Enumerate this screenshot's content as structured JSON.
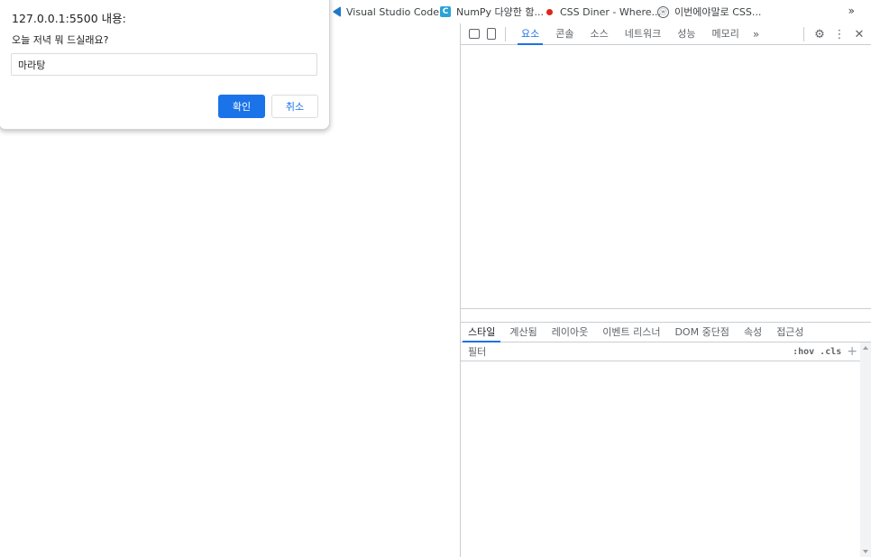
{
  "bookmarks": {
    "items": [
      {
        "label": "Visual Studio Code...",
        "icon": "vscode-icon"
      },
      {
        "label": "NumPy 다양한 함...",
        "icon": "numpy-icon",
        "icon_letter": "C"
      },
      {
        "label": "CSS Diner - Where...",
        "icon": "css-diner-icon"
      },
      {
        "label": "이번에야말로 CSS...",
        "icon": "github-icon",
        "icon_glyph": "ⓦ"
      }
    ],
    "more": "»"
  },
  "dialog": {
    "title": "127.0.0.1:5500 내용:",
    "message": "오늘 저녁 뭐 드실래요?",
    "input_value": "마라탕",
    "ok_label": "확인",
    "cancel_label": "취소"
  },
  "devtools": {
    "tabs": [
      "요소",
      "콘솔",
      "소스",
      "네트워크",
      "성능",
      "메모리"
    ],
    "active_tab": "요소",
    "more_tabs": "»",
    "icons": {
      "settings": "⚙",
      "menu": "⋮",
      "close": "✕"
    },
    "styles_tabs": [
      "스타일",
      "계산됨",
      "레이아웃",
      "이벤트 리스너",
      "DOM 중단점",
      "속성",
      "접근성"
    ],
    "active_styles_tab": "스타일",
    "filter_placeholder": "필터",
    "hov": ":hov",
    "cls": ".cls",
    "plus": "+"
  },
  "colors": {
    "accent": "#1a73e8",
    "border": "#cbcdd1"
  }
}
